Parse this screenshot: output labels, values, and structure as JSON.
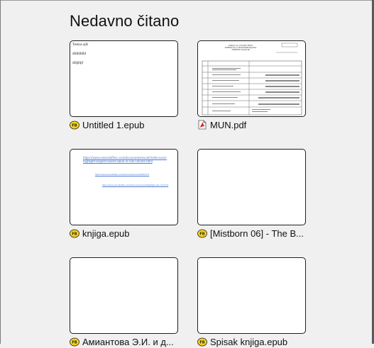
{
  "page": {
    "title": "Nedavno čitano"
  },
  "items": [
    {
      "name": "Untitled 1.epub",
      "type": "epub",
      "icon": "fb-reader-epub-icon",
      "preview_lines": [
        "Testira ojlš",
        "dfdfdfdfd",
        "dfdjfdjf"
      ]
    },
    {
      "name": "MUN.pdf",
      "type": "pdf",
      "icon": "pdf-file-icon",
      "preview_heading": [
        "ЗАВОД ЗА СТАТИСТИКУ",
        "ИЗВЕШТАЈ О МУНИЦИПИЈАМА",
        "ЗБИРНИ ПОДАЦИ"
      ]
    },
    {
      "name": "knjiga.epub",
      "type": "epub",
      "icon": "fb-reader-epub-icon",
      "preview_link": "https://www.extendoffice.com/documents/excel/3165-excel-highlight-largest-lowest-value-in-row-column.html",
      "preview_link_2": "https://www.extendoffice.com/documents/excel/3165.html",
      "preview_link_3": "https://www.extendoffice.com/documents/excel/highlight-max-min.html"
    },
    {
      "name": "[Mistborn 06] - The B...",
      "type": "epub",
      "icon": "fb-reader-epub-icon"
    },
    {
      "name": "Амиантова Э.И. и д...",
      "type": "epub",
      "icon": "fb-reader-epub-icon"
    },
    {
      "name": "Spisak knjiga.epub",
      "type": "epub",
      "icon": "fb-reader-epub-icon"
    }
  ],
  "colors": {
    "background": "#f0f0f0",
    "thumb_border": "#1f1f1f",
    "epub_icon_yellow": "#f7d21a",
    "pdf_icon_red": "#d42a2a"
  }
}
